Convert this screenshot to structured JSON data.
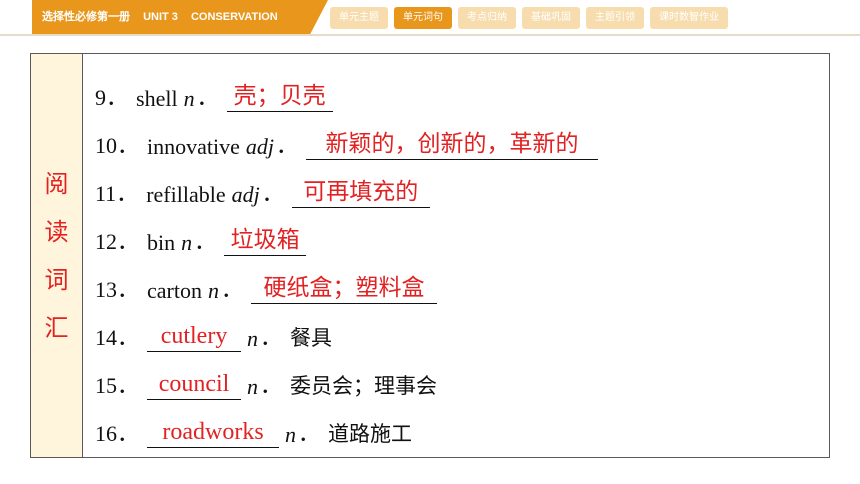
{
  "header": {
    "book": "选择性必修第一册",
    "unit": "UNIT 3",
    "unit_title": "CONSERVATION",
    "nav": [
      "单元主题",
      "单元词句",
      "考点归纳",
      "基础巩固",
      "主题引领",
      "课时数智作业"
    ],
    "active_nav": 1
  },
  "sidebar": {
    "chars": [
      "阅",
      "读",
      "词",
      "汇"
    ]
  },
  "items": [
    {
      "num": "9．",
      "word": "shell",
      "pos": "n",
      "answer": "壳；贝壳"
    },
    {
      "num": "10．",
      "word": "innovative",
      "pos": "adj",
      "answer": "新颖的，创新的，革新的"
    },
    {
      "num": "11．",
      "word": "refillable",
      "pos": "adj",
      "answer": "可再填充的"
    },
    {
      "num": "12．",
      "word": "bin",
      "pos": "n",
      "answer": "垃圾箱"
    },
    {
      "num": "13．",
      "word": "carton",
      "pos": "n",
      "answer": "硬纸盒；塑料盒"
    },
    {
      "num": "14．",
      "answer": "cutlery",
      "pos": "n",
      "meaning": "餐具"
    },
    {
      "num": "15．",
      "answer": "council",
      "pos": "n",
      "meaning": "委员会；理事会"
    },
    {
      "num": "16．",
      "answer": "roadworks",
      "pos": "n",
      "meaning": "道路施工"
    }
  ],
  "colors": {
    "accent": "#e8961c",
    "accent_light": "#f7dcae",
    "answer": "#e22222",
    "side_bg": "#fff4dc"
  }
}
